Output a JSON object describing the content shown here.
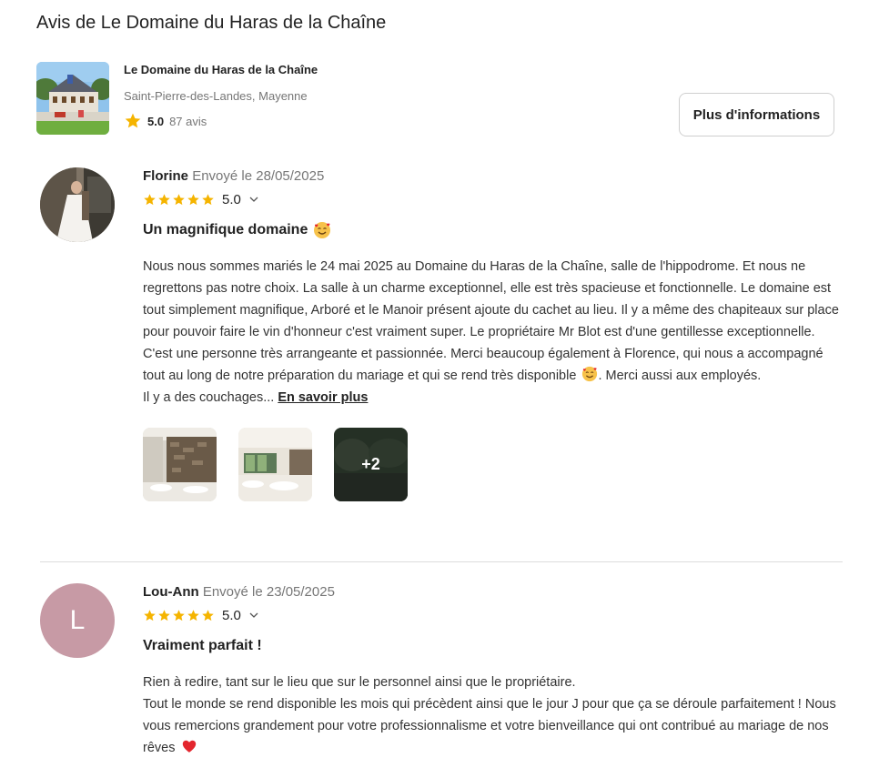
{
  "page": {
    "title": "Avis de Le Domaine du Haras de la Chaîne"
  },
  "venue": {
    "name": "Le Domaine du Haras de la Chaîne",
    "location": "Saint-Pierre-des-Landes, Mayenne",
    "rating": "5.0",
    "review_count": "87 avis",
    "more_info_label": "Plus d'informations"
  },
  "reviews": [
    {
      "author": "Florine",
      "sent": "Envoyé le 28/05/2025",
      "rating": "5.0",
      "title": "Un magnifique domaine",
      "text_part1": "Nous nous sommes mariés le 24 mai 2025 au Domaine du Haras de la Chaîne, salle de l'hippodrome. Et nous ne regrettons pas notre choix. La salle à un charme exceptionnel, elle est très spacieuse et fonctionnelle. Le domaine est tout simplement magnifique, Arboré et le Manoir présent ajoute du cachet au lieu. Il y a même des chapiteaux sur place pour pouvoir faire le vin d'honneur c'est vraiment super. Le propriétaire Mr Blot est d'une gentillesse exceptionnelle. C'est une personne très arrangeante et passionnée. Merci beaucoup également à Florence, qui nous a accompagné tout au long de notre préparation du mariage et qui se rend très disponible",
      "text_part2": ". Merci aussi aux employés.",
      "text_part3": "Il y a des couchages...",
      "read_more": "En savoir plus",
      "more_photos": "+2"
    },
    {
      "author": "Lou-Ann",
      "sent": "Envoyé le 23/05/2025",
      "rating": "5.0",
      "avatar_letter": "L",
      "title": "Vraiment parfait !",
      "line1": "Rien à redire, tant sur le lieu que sur le personnel ainsi que le propriétaire.",
      "line2": "Tout le monde se rend disponible les mois qui précèdent ainsi que le jour J pour que ça se déroule parfaitement ! Nous vous remercions grandement pour votre professionnalisme et votre bienveillance qui ont contribué au mariage de nos rêves"
    }
  ],
  "colors": {
    "star": "#f5b400",
    "avatar_bg": "#c79aa5",
    "heart": "#e3262e"
  }
}
